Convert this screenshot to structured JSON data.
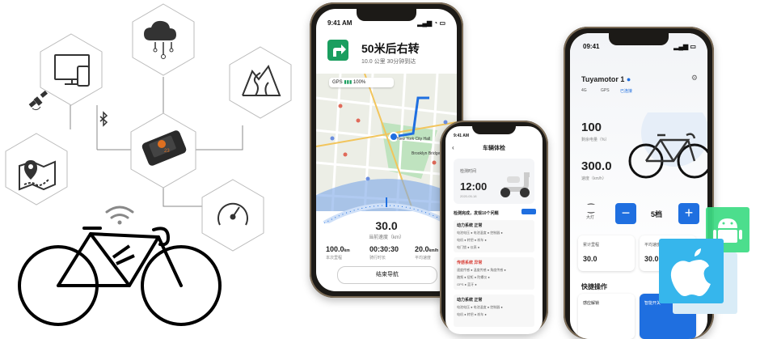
{
  "phone1": {
    "status_time": "9:41 AM",
    "nav_title": "50米后右转",
    "nav_sub": "10.0 公里  30分钟到达",
    "gps_label": "GPS",
    "battery_label": "100%",
    "speed_value": "30.0",
    "speed_label": "当前速度（km）",
    "stats": [
      {
        "value": "100.0",
        "unit": "km",
        "label": "本次里程"
      },
      {
        "value": "00:30:30",
        "unit": "",
        "label": "骑行时长"
      },
      {
        "value": "20.0",
        "unit": "km/h",
        "label": "平均速度"
      }
    ],
    "end_nav": "结束导航",
    "map_labels": [
      "New York City Hall",
      "Brooklyn Bridge"
    ]
  },
  "phone2": {
    "status_time": "9:41 AM",
    "title": "车辆体检",
    "scooter_label": "检测时间",
    "time": "12:00",
    "date": "2020-05-18",
    "warning": "检测完成，发现10个问题",
    "sections": [
      {
        "title": "动力系统  正常",
        "rows": [
          "电池电压 ●   电池温度 ●   控制器 ●",
          "电机 ●   转把 ●   刹车 ●",
          "电门锁 ●   仪表 ●"
        ]
      },
      {
        "title": "传感系统  异常",
        "rows": [
          "速度传感 ●   温度传感 ●   角度传感 ●",
          "踏频 ●   扭矩 ●   陀螺仪 ●",
          "GPS ●   蓝牙 ●"
        ]
      },
      {
        "title": "动力系统  正常",
        "rows": [
          "电池电压 ●   电池温度 ●   控制器 ●",
          "电机 ●   转把 ●   刹车 ●"
        ]
      }
    ]
  },
  "phone3": {
    "status_time": "09:41",
    "title": "Tuyamotor 1",
    "status_items": [
      "4G",
      "GPS",
      "已连接"
    ],
    "battery_value": "100",
    "battery_label": "剩余电量（%）",
    "speed_value": "300.0",
    "speed_label": "速度（km/h）",
    "gear_label": "5档",
    "headlight_label": "大灯",
    "minus": "−",
    "plus": "+",
    "card1_label": "累计里程",
    "card1_value": "30.0",
    "card2_label": "平均速度",
    "card2_value": "30.0",
    "quick_title": "快捷操作",
    "quick_items": [
      "感应解锁",
      "智能开关"
    ]
  },
  "colors": {
    "accent": "#1f6fe0",
    "nav_green": "#1a9e5f",
    "android": "#3ddc84",
    "apple": "#36b6ec"
  },
  "icons": [
    "cloud-network-icon",
    "monitor-phone-icon",
    "mountain-road-icon",
    "satellite-icon",
    "bluetooth-icon",
    "bike-computer-icon",
    "map-pin-icon",
    "speedometer-icon",
    "wifi-icon",
    "bicycle-icon",
    "android-icon",
    "apple-icon"
  ]
}
